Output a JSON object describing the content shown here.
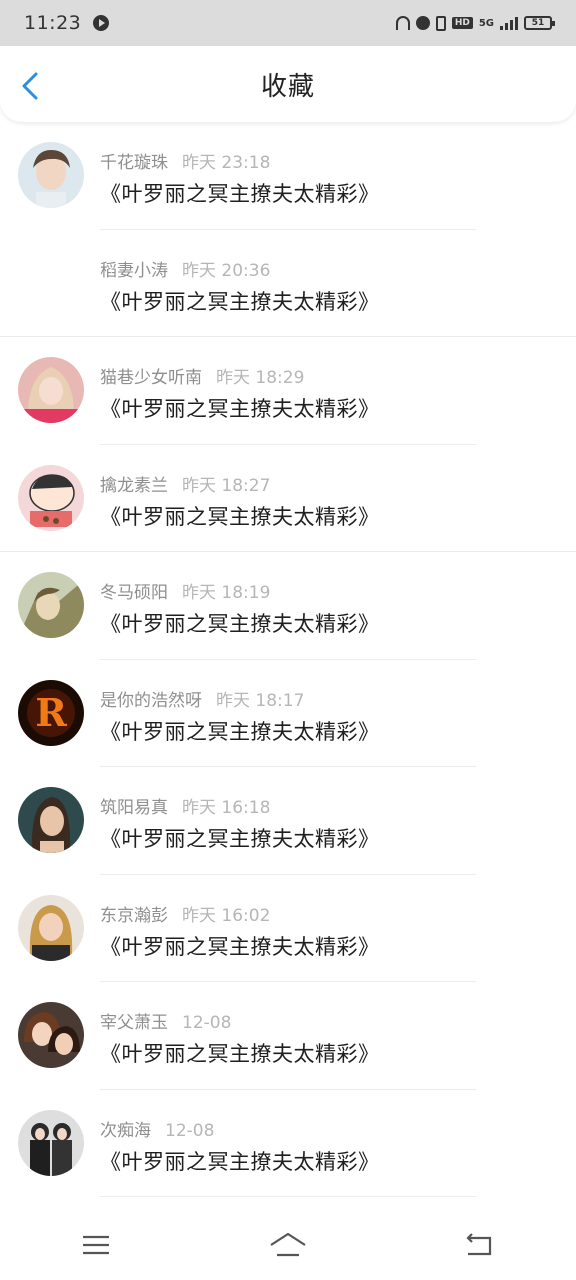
{
  "status_bar": {
    "time": "11:23",
    "network": "5G",
    "battery": "51"
  },
  "header": {
    "title": "收藏",
    "accent_color": "#2a8fe0"
  },
  "items": [
    {
      "user": "千花璇珠",
      "time": "昨天 23:18",
      "content": "《叶罗丽之冥主撩夫太精彩》",
      "avatar": "person-boy-photo"
    },
    {
      "user": "稻妻小涛",
      "time": "昨天 20:36",
      "content": "《叶罗丽之冥主撩夫太精彩》",
      "avatar": ""
    },
    {
      "user": "猫巷少女听南",
      "time": "昨天 18:29",
      "content": "《叶罗丽之冥主撩夫太精彩》",
      "avatar": "person-girl-photo"
    },
    {
      "user": "擒龙素兰",
      "time": "昨天 18:27",
      "content": "《叶罗丽之冥主撩夫太精彩》",
      "avatar": "cartoon-shinchan"
    },
    {
      "user": "冬马硕阳",
      "time": "昨天 18:19",
      "content": "《叶罗丽之冥主撩夫太精彩》",
      "avatar": "anime-character"
    },
    {
      "user": "是你的浩然呀",
      "time": "昨天 18:17",
      "content": "《叶罗丽之冥主撩夫太精彩》",
      "avatar": "fire-letter-r"
    },
    {
      "user": "筑阳易真",
      "time": "昨天 16:18",
      "content": "《叶罗丽之冥主撩夫太精彩》",
      "avatar": "person-woman-photo"
    },
    {
      "user": "东京瀚彭",
      "time": "昨天 16:02",
      "content": "《叶罗丽之冥主撩夫太精彩》",
      "avatar": "person-woman-blonde"
    },
    {
      "user": "宰父萧玉",
      "time": "12-08",
      "content": "《叶罗丽之冥主撩夫太精彩》",
      "avatar": "anime-couple"
    },
    {
      "user": "次痴海",
      "time": "12-08",
      "content": "《叶罗丽之冥主撩夫太精彩》",
      "avatar": "two-people-photo"
    }
  ],
  "bottom_nav": {
    "buttons": [
      "menu-icon",
      "home-icon",
      "back-icon"
    ]
  }
}
